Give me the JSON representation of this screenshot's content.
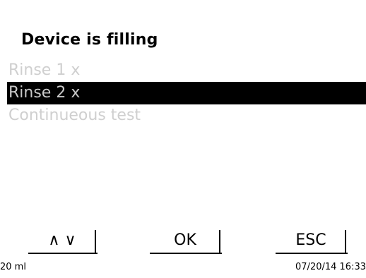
{
  "title": "Device is filling",
  "menu": {
    "items": [
      {
        "label": "Rinse 1 x",
        "selected": false
      },
      {
        "label": "Rinse 2 x",
        "selected": true
      },
      {
        "label": "Continueous test",
        "selected": false
      }
    ]
  },
  "softkeys": {
    "updown": "∧ ∨",
    "ok": "OK",
    "esc": "ESC"
  },
  "status": {
    "volume": "20 ml",
    "datetime": "07/20/14 16:33"
  }
}
